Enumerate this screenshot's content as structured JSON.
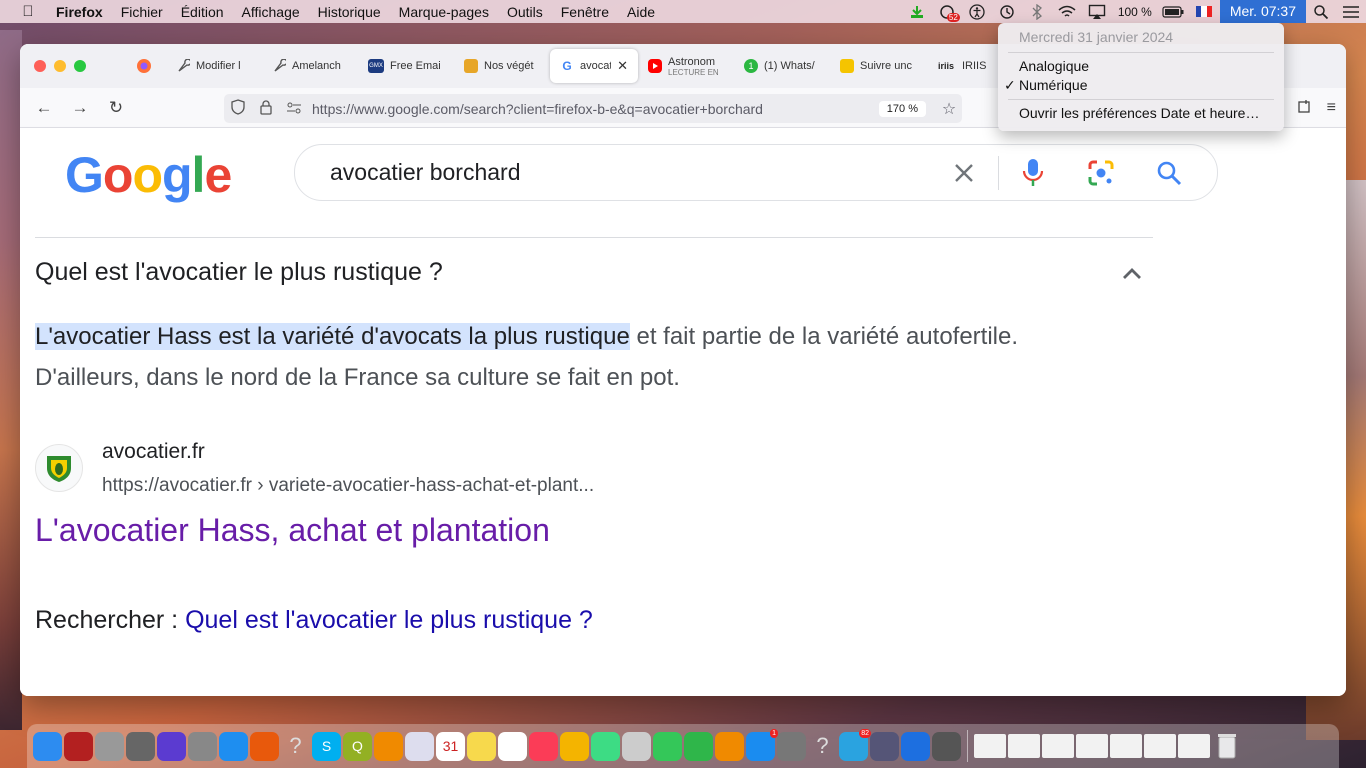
{
  "menubar": {
    "app": "Firefox",
    "menus": [
      "Fichier",
      "Édition",
      "Affichage",
      "Historique",
      "Marque-pages",
      "Outils",
      "Fenêtre",
      "Aide"
    ],
    "status_badge": "52",
    "battery": "100 %",
    "clock": "Mer. 07:37"
  },
  "clock_menu": {
    "date": "Mercredi 31 janvier 2024",
    "analog": "Analogique",
    "digital": "Numérique",
    "checkmark": "✓",
    "prefs": "Ouvrir les préférences Date et heure…"
  },
  "tabs": [
    {
      "label": "Modifier l",
      "color": "#555"
    },
    {
      "label": "Amelanch",
      "color": "#555"
    },
    {
      "label": "Free Emai",
      "color": "#1c3b80",
      "fav_text": "GMX"
    },
    {
      "label": "Nos végét",
      "color": "#e7a628"
    },
    {
      "label": "avocati",
      "color": "#4285f4",
      "fav_text": "G"
    },
    {
      "label": "Astronom",
      "sub": "LECTURE EN",
      "color": "#ff0000"
    },
    {
      "label": "(1) Whats/",
      "color": "#2bb741",
      "fav_text": "1"
    },
    {
      "label": "Suivre unc",
      "color": "#f5c400"
    },
    {
      "label": "IRIIS",
      "color": "#222",
      "fav_text": "iriis"
    }
  ],
  "nav": {
    "url": "https://www.google.com/search?client=firefox-b-e&q=avocatier+borchard",
    "zoom": "170 %"
  },
  "google": {
    "logo_letters": [
      {
        "t": "G",
        "c": "#4285f4"
      },
      {
        "t": "o",
        "c": "#ea4335"
      },
      {
        "t": "o",
        "c": "#fbbc05"
      },
      {
        "t": "g",
        "c": "#4285f4"
      },
      {
        "t": "l",
        "c": "#34a853"
      },
      {
        "t": "e",
        "c": "#ea4335"
      }
    ],
    "query": "avocatier borchard"
  },
  "result": {
    "question": "Quel est l'avocatier le plus rustique ?",
    "answer_highlight": "L'avocatier Hass est la variété d'avocats la plus rustique",
    "answer_rest": " et fait partie de la variété autofertile. D'ailleurs, dans le nord de la France sa culture se fait en pot.",
    "source_name": "avocatier.fr",
    "source_url": "https://avocatier.fr › variete-avocatier-hass-achat-et-plant...",
    "link_title": "L'avocatier Hass, achat et plantation",
    "related_prefix": "Rechercher : ",
    "related_link": "Quel est l'avocatier le plus rustique ?"
  },
  "dock": {
    "apps": [
      {
        "name": "finder-icon",
        "c": "#2d8cf0",
        "t": ""
      },
      {
        "name": "photo-booth-icon",
        "c": "#b32020",
        "t": ""
      },
      {
        "name": "disk-utility-icon",
        "c": "#999",
        "t": ""
      },
      {
        "name": "calculator-icon",
        "c": "#666",
        "t": ""
      },
      {
        "name": "siri-icon",
        "c": "#5b3bd0",
        "t": ""
      },
      {
        "name": "launchpad-icon",
        "c": "#888",
        "t": ""
      },
      {
        "name": "safari-icon",
        "c": "#1e8ef0",
        "t": ""
      },
      {
        "name": "firefox-icon",
        "c": "#e8590c",
        "t": ""
      },
      {
        "name": "unknown-app-icon",
        "c": "transparent",
        "t": "?"
      },
      {
        "name": "skype-icon",
        "c": "#00aff0",
        "t": "S"
      },
      {
        "name": "qgis-icon",
        "c": "#93b023",
        "t": "Q"
      },
      {
        "name": "vlc-icon",
        "c": "#f08a00",
        "t": ""
      },
      {
        "name": "cyberduck-icon",
        "c": "#dde",
        "t": ""
      },
      {
        "name": "calendar-icon",
        "c": "#fff",
        "t": "31"
      },
      {
        "name": "notes-icon",
        "c": "#f7d94c",
        "t": ""
      },
      {
        "name": "reminders-icon",
        "c": "#fff",
        "t": ""
      },
      {
        "name": "music-icon",
        "c": "#fb3c57",
        "t": ""
      },
      {
        "name": "photos-icon",
        "c": "#f4b400",
        "t": ""
      },
      {
        "name": "android-icon",
        "c": "#3ddc84",
        "t": ""
      },
      {
        "name": "preview-icon",
        "c": "#ccc",
        "t": ""
      },
      {
        "name": "messages-icon",
        "c": "#34c759",
        "t": ""
      },
      {
        "name": "facetime-icon",
        "c": "#2fb64a",
        "t": ""
      },
      {
        "name": "books-icon",
        "c": "#f08a00",
        "t": ""
      },
      {
        "name": "app-store-icon",
        "c": "#1a8cf0",
        "t": "",
        "badge": "1"
      },
      {
        "name": "system-preferences-icon",
        "c": "#777",
        "t": ""
      },
      {
        "name": "unknown-app-icon-2",
        "c": "transparent",
        "t": "?"
      },
      {
        "name": "telegram-icon",
        "c": "#2aa3e0",
        "t": "",
        "badge": "82"
      },
      {
        "name": "image-capture-icon",
        "c": "#557",
        "t": ""
      },
      {
        "name": "teamviewer-icon",
        "c": "#1d6fe0",
        "t": ""
      },
      {
        "name": "whatsapp-icon",
        "c": "#555",
        "t": ""
      }
    ],
    "windows": 7
  }
}
